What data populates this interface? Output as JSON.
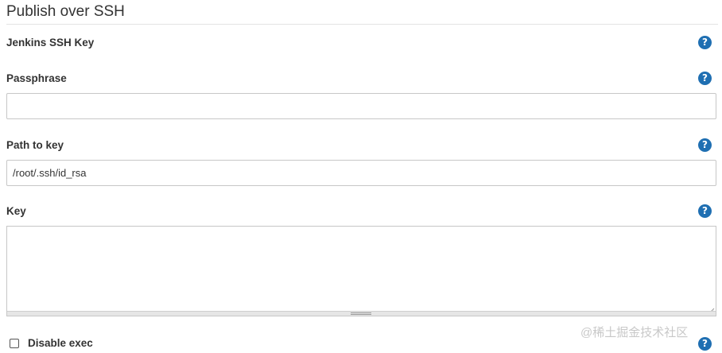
{
  "section": {
    "title": "Publish over SSH"
  },
  "fields": {
    "jenkins_ssh_key": {
      "label": "Jenkins SSH Key"
    },
    "passphrase": {
      "label": "Passphrase",
      "value": ""
    },
    "path_to_key": {
      "label": "Path to key",
      "value": "/root/.ssh/id_rsa"
    },
    "key": {
      "label": "Key",
      "value": ""
    }
  },
  "disable_exec": {
    "label": "Disable exec",
    "checked": false
  },
  "help_icon": {
    "glyph": "?",
    "color": "#1f6fb2"
  },
  "watermark": {
    "text": "@稀土掘金技术社区"
  }
}
